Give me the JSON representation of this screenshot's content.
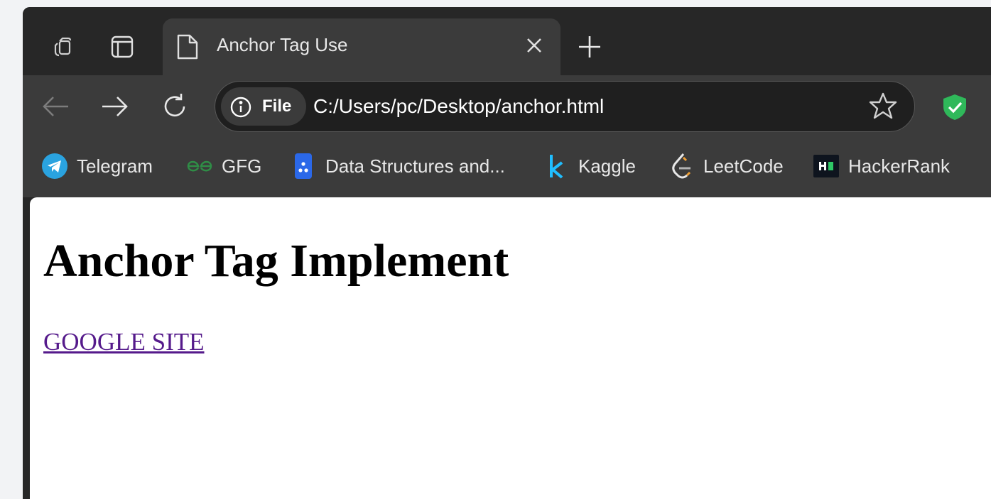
{
  "browser": {
    "tab": {
      "title": "Anchor Tag Use"
    },
    "omnibox": {
      "scheme_label": "File",
      "url": "C:/Users/pc/Desktop/anchor.html"
    },
    "bookmarks": [
      {
        "label": "Telegram",
        "icon": "telegram-icon"
      },
      {
        "label": "GFG",
        "icon": "gfg-icon"
      },
      {
        "label": "Data Structures and...",
        "icon": "data-structures-icon"
      },
      {
        "label": "Kaggle",
        "icon": "kaggle-icon"
      },
      {
        "label": "LeetCode",
        "icon": "leetcode-icon"
      },
      {
        "label": "HackerRank",
        "icon": "hackerrank-icon"
      }
    ],
    "colors": {
      "frame": "#272727",
      "toolbar": "#3b3b3b",
      "shield": "#2fb85a",
      "link_visited": "#551a8b"
    }
  },
  "page": {
    "heading": "Anchor Tag Implement",
    "link_text": "GOOGLE SITE"
  }
}
